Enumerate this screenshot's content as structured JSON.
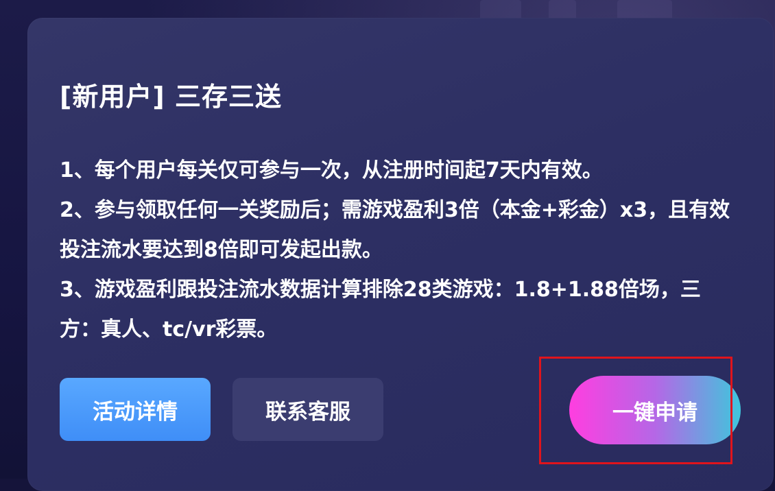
{
  "card": {
    "title": "[新用户] 三存三送",
    "rules": [
      "1、每个用户每关仅可参与一次，从注册时间起7天内有效。",
      "2、参与领取任何一关奖励后；需游戏盈利3倍（本金+彩金）x3，且有效投注流水要达到8倍即可发起出款。",
      "3、游戏盈利跟投注流水数据计算排除28类游戏：1.8+1.88倍场，三方：真人、tc/vr彩票。"
    ],
    "buttons": {
      "details": "活动详情",
      "contact": "联系客服",
      "apply": "一键申请"
    }
  },
  "colors": {
    "details_button": "#4a9bfb",
    "contact_button": "#3b3d70",
    "apply_gradient_start": "#ff3ee0",
    "apply_gradient_end": "#3fc6dc",
    "highlight_outline": "#e0141c"
  }
}
